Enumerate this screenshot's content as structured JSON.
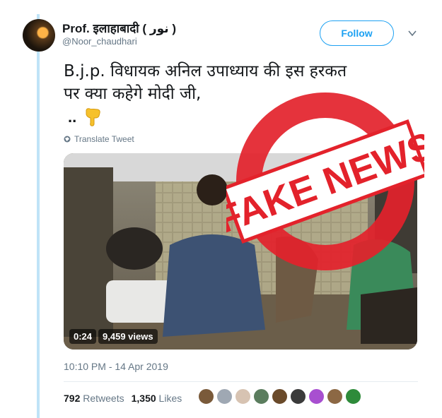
{
  "author": {
    "name": "Prof. इलाहाबादी ( نور )",
    "handle": "@Noor_chaudhari"
  },
  "follow_button": {
    "label": "Follow"
  },
  "tweet": {
    "line1": "B.j.p. विधायक अनिल उपाध्याय की इस हरकत",
    "line2": "पर क्या कहेगे मोदी जी,",
    "line3": ".."
  },
  "translate": {
    "label": "Translate Tweet"
  },
  "media": {
    "duration": "0:24",
    "views": "9,459 views",
    "stamp_text": "FAKE NEWS"
  },
  "timestamp": "10:10 PM - 14 Apr 2019",
  "stats": {
    "retweets_count": "792",
    "retweets_label": "Retweets",
    "likes_count": "1,350",
    "likes_label": "Likes"
  },
  "colors": {
    "accent": "#1da1f2",
    "stamp_red": "#e3222b",
    "muted_text": "#657786"
  },
  "likers": [
    {
      "name": "liker-avatar-1",
      "color": "#7a5a3a"
    },
    {
      "name": "liker-avatar-2",
      "color": "#9fa8b3"
    },
    {
      "name": "liker-avatar-3",
      "color": "#d7c3b2"
    },
    {
      "name": "liker-avatar-4",
      "color": "#5b7d5e"
    },
    {
      "name": "liker-avatar-5",
      "color": "#6a4a2a"
    },
    {
      "name": "liker-avatar-6",
      "color": "#3b3b3b"
    },
    {
      "name": "liker-avatar-7",
      "color": "#a84fd0"
    },
    {
      "name": "liker-avatar-8",
      "color": "#8c6844"
    },
    {
      "name": "liker-avatar-9",
      "color": "#2e8b3a"
    }
  ]
}
